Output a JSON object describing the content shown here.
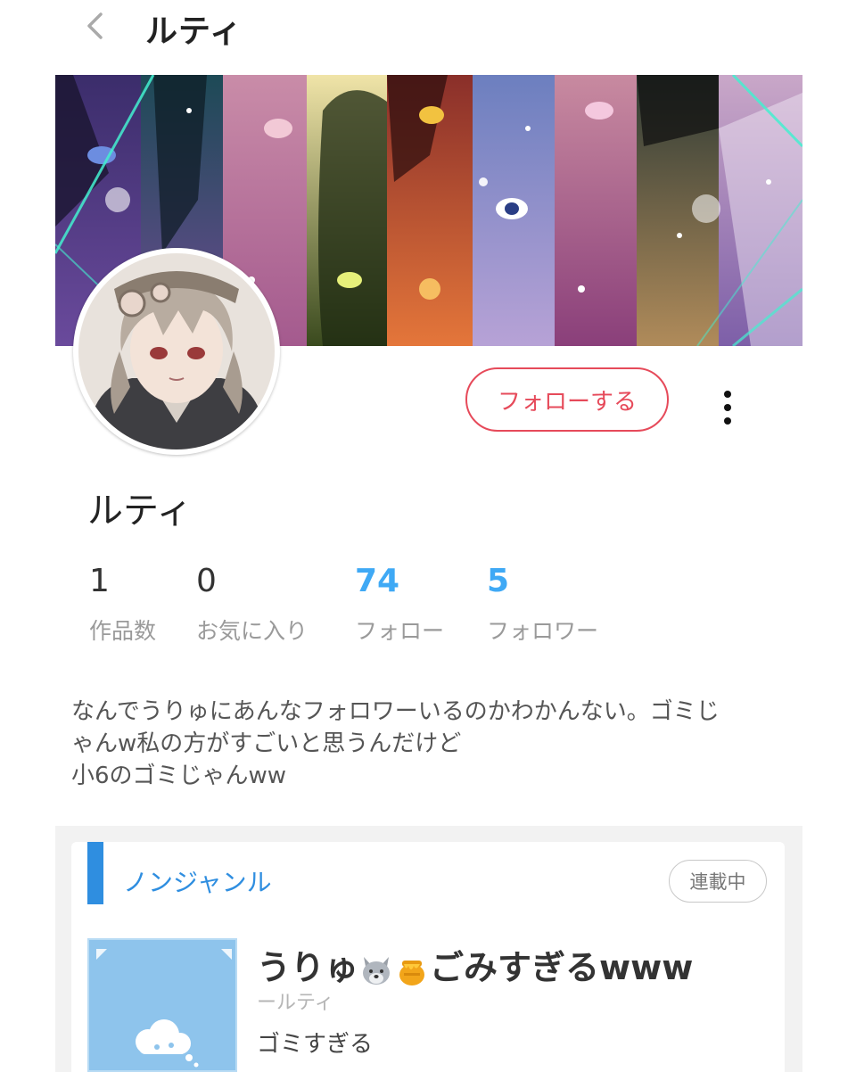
{
  "header": {
    "title": "ルティ"
  },
  "profile": {
    "name": "ルティ",
    "follow_label": "フォローする",
    "stats": [
      {
        "value": "1",
        "label": "作品数"
      },
      {
        "value": "0",
        "label": "お気に入り"
      },
      {
        "value": "74",
        "label": "フォロー"
      },
      {
        "value": "5",
        "label": "フォロワー"
      }
    ],
    "bio_lines": [
      "なんでうりゅにあんなフォロワーいるのかわかんない。ゴミじ",
      "ゃんw私の方がすごいと思うんだけど",
      "小6のゴミじゃんww"
    ]
  },
  "work": {
    "genre": "ノンジャンル",
    "status": "連載中",
    "title_part1": "うりゅ",
    "title_part2": "ごみすぎるwww",
    "author": "ールティ",
    "description": "ゴミすぎる"
  },
  "colors": {
    "follow_accent": "#e64a5a",
    "stat_link": "#3fa9f5",
    "genre_blue": "#2f8ee0",
    "cover_blue": "#8ec4ec"
  },
  "icons": [
    "back-chevron-icon",
    "more-vertical-icon",
    "wolf-emoji-icon",
    "honey-pot-emoji-icon",
    "cloud-icon"
  ]
}
